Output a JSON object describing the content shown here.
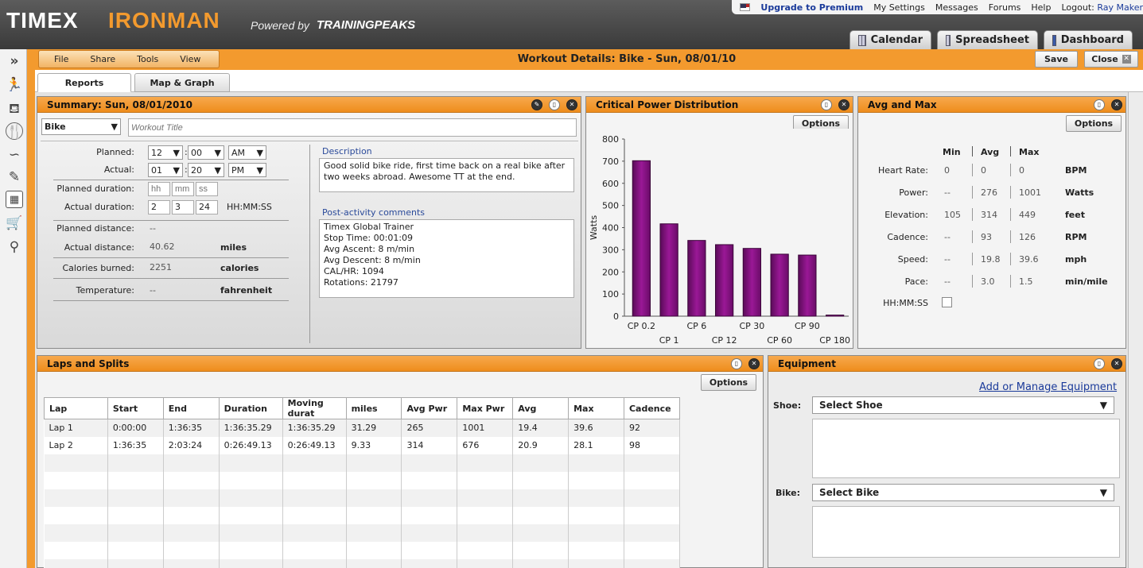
{
  "header": {
    "brand_timex": "TIMEX",
    "brand_ironman": "IRONMAN",
    "powered_by": "Powered by",
    "brand_tp": "TRAININGPEAKS",
    "links": {
      "upgrade": "Upgrade to Premium",
      "settings": "My Settings",
      "messages": "Messages",
      "forums": "Forums",
      "help": "Help",
      "logout": "Logout:",
      "user": "Ray Maker"
    },
    "tabs": {
      "calendar": "Calendar",
      "spreadsheet": "Spreadsheet",
      "dashboard": "Dashboard"
    }
  },
  "sidebar": {
    "collapse": "»"
  },
  "toolbar": {
    "menu": {
      "file": "File",
      "share": "Share",
      "tools": "Tools",
      "view": "View"
    },
    "title": "Workout Details: Bike - Sun, 08/01/10",
    "save": "Save",
    "close": "Close"
  },
  "subtabs": {
    "reports": "Reports",
    "map": "Map & Graph"
  },
  "summary": {
    "title": "Summary: Sun, 08/01/2010",
    "sport": "Bike",
    "workout_title_placeholder": "Workout Title",
    "planned_label": "Planned:",
    "planned_hour": "12",
    "planned_min": "00",
    "planned_ampm": "AM",
    "actual_label": "Actual:",
    "actual_hour": "01",
    "actual_min": "20",
    "actual_ampm": "PM",
    "planned_duration_label": "Planned duration:",
    "ph": "hh",
    "pm": "mm",
    "ps": "ss",
    "actual_duration_label": "Actual duration:",
    "ad_h": "2",
    "ad_m": "3",
    "ad_s": "24",
    "duration_format": "HH:MM:SS",
    "planned_distance_label": "Planned distance:",
    "planned_distance": "--",
    "actual_distance_label": "Actual distance:",
    "actual_distance": "40.62",
    "distance_unit": "miles",
    "calories_label": "Calories burned:",
    "calories": "2251",
    "calories_unit": "calories",
    "temperature_label": "Temperature:",
    "temperature": "--",
    "temperature_unit": "fahrenheit",
    "description_label": "Description",
    "description": "Good solid bike ride, first time back on a real bike after two weeks abroad.  Awesome TT at the end.",
    "post_label": "Post-activity comments",
    "post_lines": [
      "Timex Global Trainer",
      "Stop Time: 00:01:09",
      "Avg Ascent: 8 m/min",
      "Avg Descent: 8 m/min",
      "CAL/HR: 1094",
      "Rotations: 21797"
    ]
  },
  "cp": {
    "title": "Critical Power Distribution",
    "options": "Options"
  },
  "chart_data": {
    "type": "bar",
    "ylabel": "Watts",
    "ylim": [
      0,
      800
    ],
    "yticks": [
      0,
      100,
      200,
      300,
      400,
      500,
      600,
      700,
      800
    ],
    "categories": [
      "CP 0.2",
      "CP 1",
      "CP 6",
      "CP 12",
      "CP 30",
      "CP 60",
      "CP 90",
      "CP 180"
    ],
    "values": [
      702,
      417,
      342,
      323,
      306,
      280,
      276,
      5
    ],
    "color": "#9a1896",
    "grid": false
  },
  "avgmax": {
    "title": "Avg and Max",
    "options": "Options",
    "col_min": "Min",
    "col_avg": "Avg",
    "col_max": "Max",
    "rows": [
      {
        "label": "Heart Rate:",
        "min": "0",
        "avg": "0",
        "max": "0",
        "unit": "BPM"
      },
      {
        "label": "Power:",
        "min": "--",
        "avg": "276",
        "max": "1001",
        "unit": "Watts"
      },
      {
        "label": "Elevation:",
        "min": "105",
        "avg": "314",
        "max": "449",
        "unit": "feet"
      },
      {
        "label": "Cadence:",
        "min": "--",
        "avg": "93",
        "max": "126",
        "unit": "RPM"
      },
      {
        "label": "Speed:",
        "min": "--",
        "avg": "19.8",
        "max": "39.6",
        "unit": "mph"
      },
      {
        "label": "Pace:",
        "min": "--",
        "avg": "3.0",
        "max": "1.5",
        "unit": "min/mile"
      }
    ],
    "hhmmss_label": "HH:MM:SS"
  },
  "laps": {
    "title": "Laps and Splits",
    "options": "Options",
    "columns": [
      "Lap",
      "Start",
      "End",
      "Duration",
      "Moving durat",
      "miles",
      "Avg Pwr",
      "Max Pwr",
      "Avg",
      "Max",
      "Cadence"
    ],
    "rows": [
      [
        "Lap 1",
        "0:00:00",
        "1:36:35",
        "1:36:35.29",
        "1:36:35.29",
        "31.29",
        "265",
        "1001",
        "19.4",
        "39.6",
        "92"
      ],
      [
        "Lap 2",
        "1:36:35",
        "2:03:24",
        "0:26:49.13",
        "0:26:49.13",
        "9.33",
        "314",
        "676",
        "20.9",
        "28.1",
        "98"
      ]
    ]
  },
  "equipment": {
    "title": "Equipment",
    "manage_link": "Add or Manage Equipment",
    "shoe_label": "Shoe:",
    "shoe_value": "Select Shoe",
    "bike_label": "Bike:",
    "bike_value": "Select Bike"
  }
}
